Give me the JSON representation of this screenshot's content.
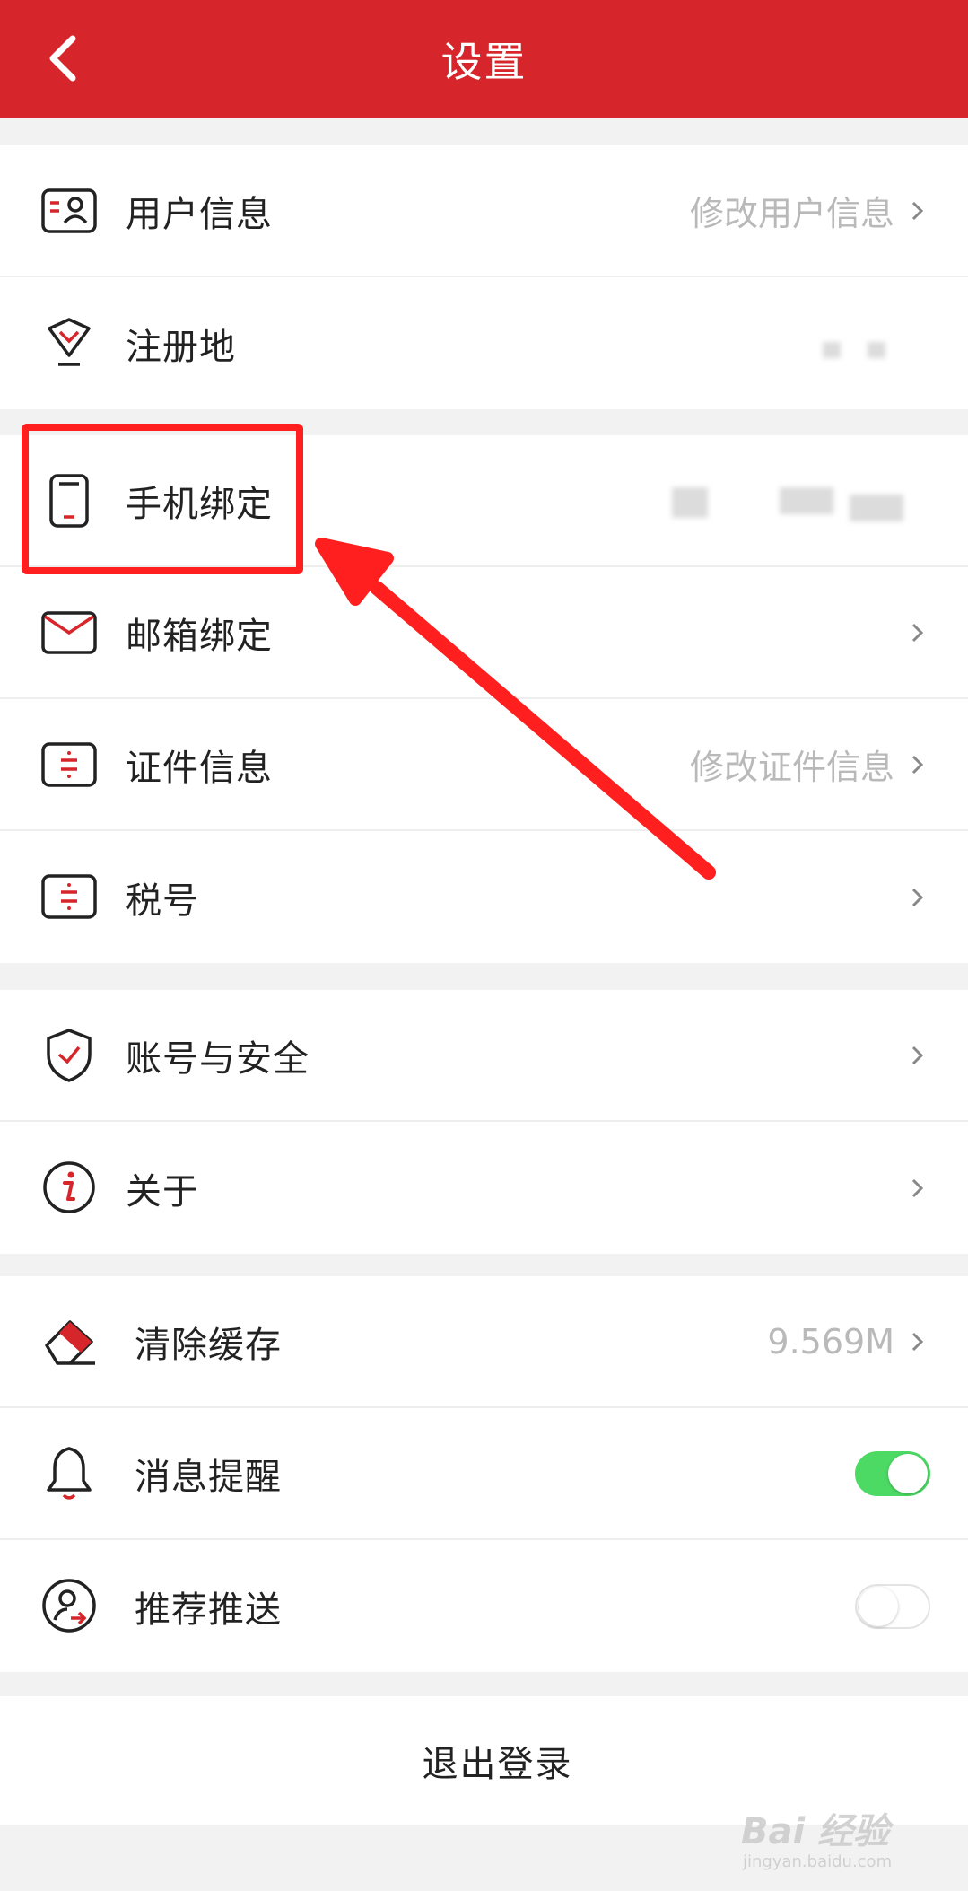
{
  "header": {
    "title": "设置",
    "back_icon": "chevron-left-icon"
  },
  "groups": [
    {
      "rows": [
        {
          "label": "用户信息",
          "value": "修改用户信息",
          "icon": "user-card-icon",
          "chevron": true
        },
        {
          "label": "注册地",
          "value": "",
          "icon": "location-diamond-icon",
          "chevron": false
        }
      ]
    },
    {
      "rows": [
        {
          "label": "手机绑定",
          "value": "",
          "icon": "phone-icon",
          "chevron": false
        },
        {
          "label": "邮箱绑定",
          "value": "",
          "icon": "mail-icon",
          "chevron": true
        },
        {
          "label": "证件信息",
          "value": "修改证件信息",
          "icon": "id-document-icon",
          "chevron": true
        },
        {
          "label": "税号",
          "value": "",
          "icon": "tax-document-icon",
          "chevron": true
        }
      ]
    },
    {
      "rows": [
        {
          "label": "账号与安全",
          "value": "",
          "icon": "shield-check-icon",
          "chevron": true
        },
        {
          "label": "关于",
          "value": "",
          "icon": "info-icon",
          "chevron": true
        }
      ]
    },
    {
      "rows": [
        {
          "label": "清除缓存",
          "value": "9.569M",
          "icon": "eraser-icon",
          "chevron": true
        },
        {
          "label": "消息提醒",
          "icon": "bell-icon",
          "toggle": true
        },
        {
          "label": "推荐推送",
          "icon": "recommend-push-icon",
          "toggle": false
        }
      ]
    }
  ],
  "logout": {
    "label": "退出登录"
  },
  "watermark": {
    "logo": "Bai 经验",
    "url": "jingyan.baidu.com"
  },
  "colors": {
    "brand": "#d7262b",
    "toggle_on": "#4cd964",
    "annotation": "#ff1f1f"
  }
}
